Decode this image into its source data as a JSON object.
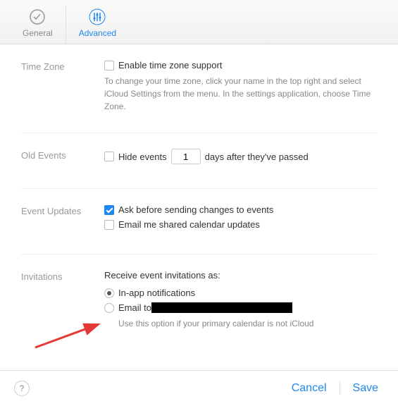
{
  "tabs": {
    "general": "General",
    "advanced": "Advanced"
  },
  "timezone": {
    "label": "Time Zone",
    "enable": "Enable time zone support",
    "help": "To change your time zone, click your name in the top right and select iCloud Settings from the menu. In the settings application, choose Time Zone."
  },
  "old_events": {
    "label": "Old Events",
    "hide_pre": "Hide events",
    "hide_post": "days after they've passed",
    "value": "1"
  },
  "updates": {
    "label": "Event Updates",
    "ask": "Ask before sending changes to events",
    "email": "Email me shared calendar updates"
  },
  "invitations": {
    "label": "Invitations",
    "intro": "Receive event invitations as:",
    "inapp": "In-app notifications",
    "emailto": "Email to",
    "help": "Use this option if your primary calendar is not iCloud"
  },
  "footer": {
    "help": "?",
    "cancel": "Cancel",
    "save": "Save"
  }
}
